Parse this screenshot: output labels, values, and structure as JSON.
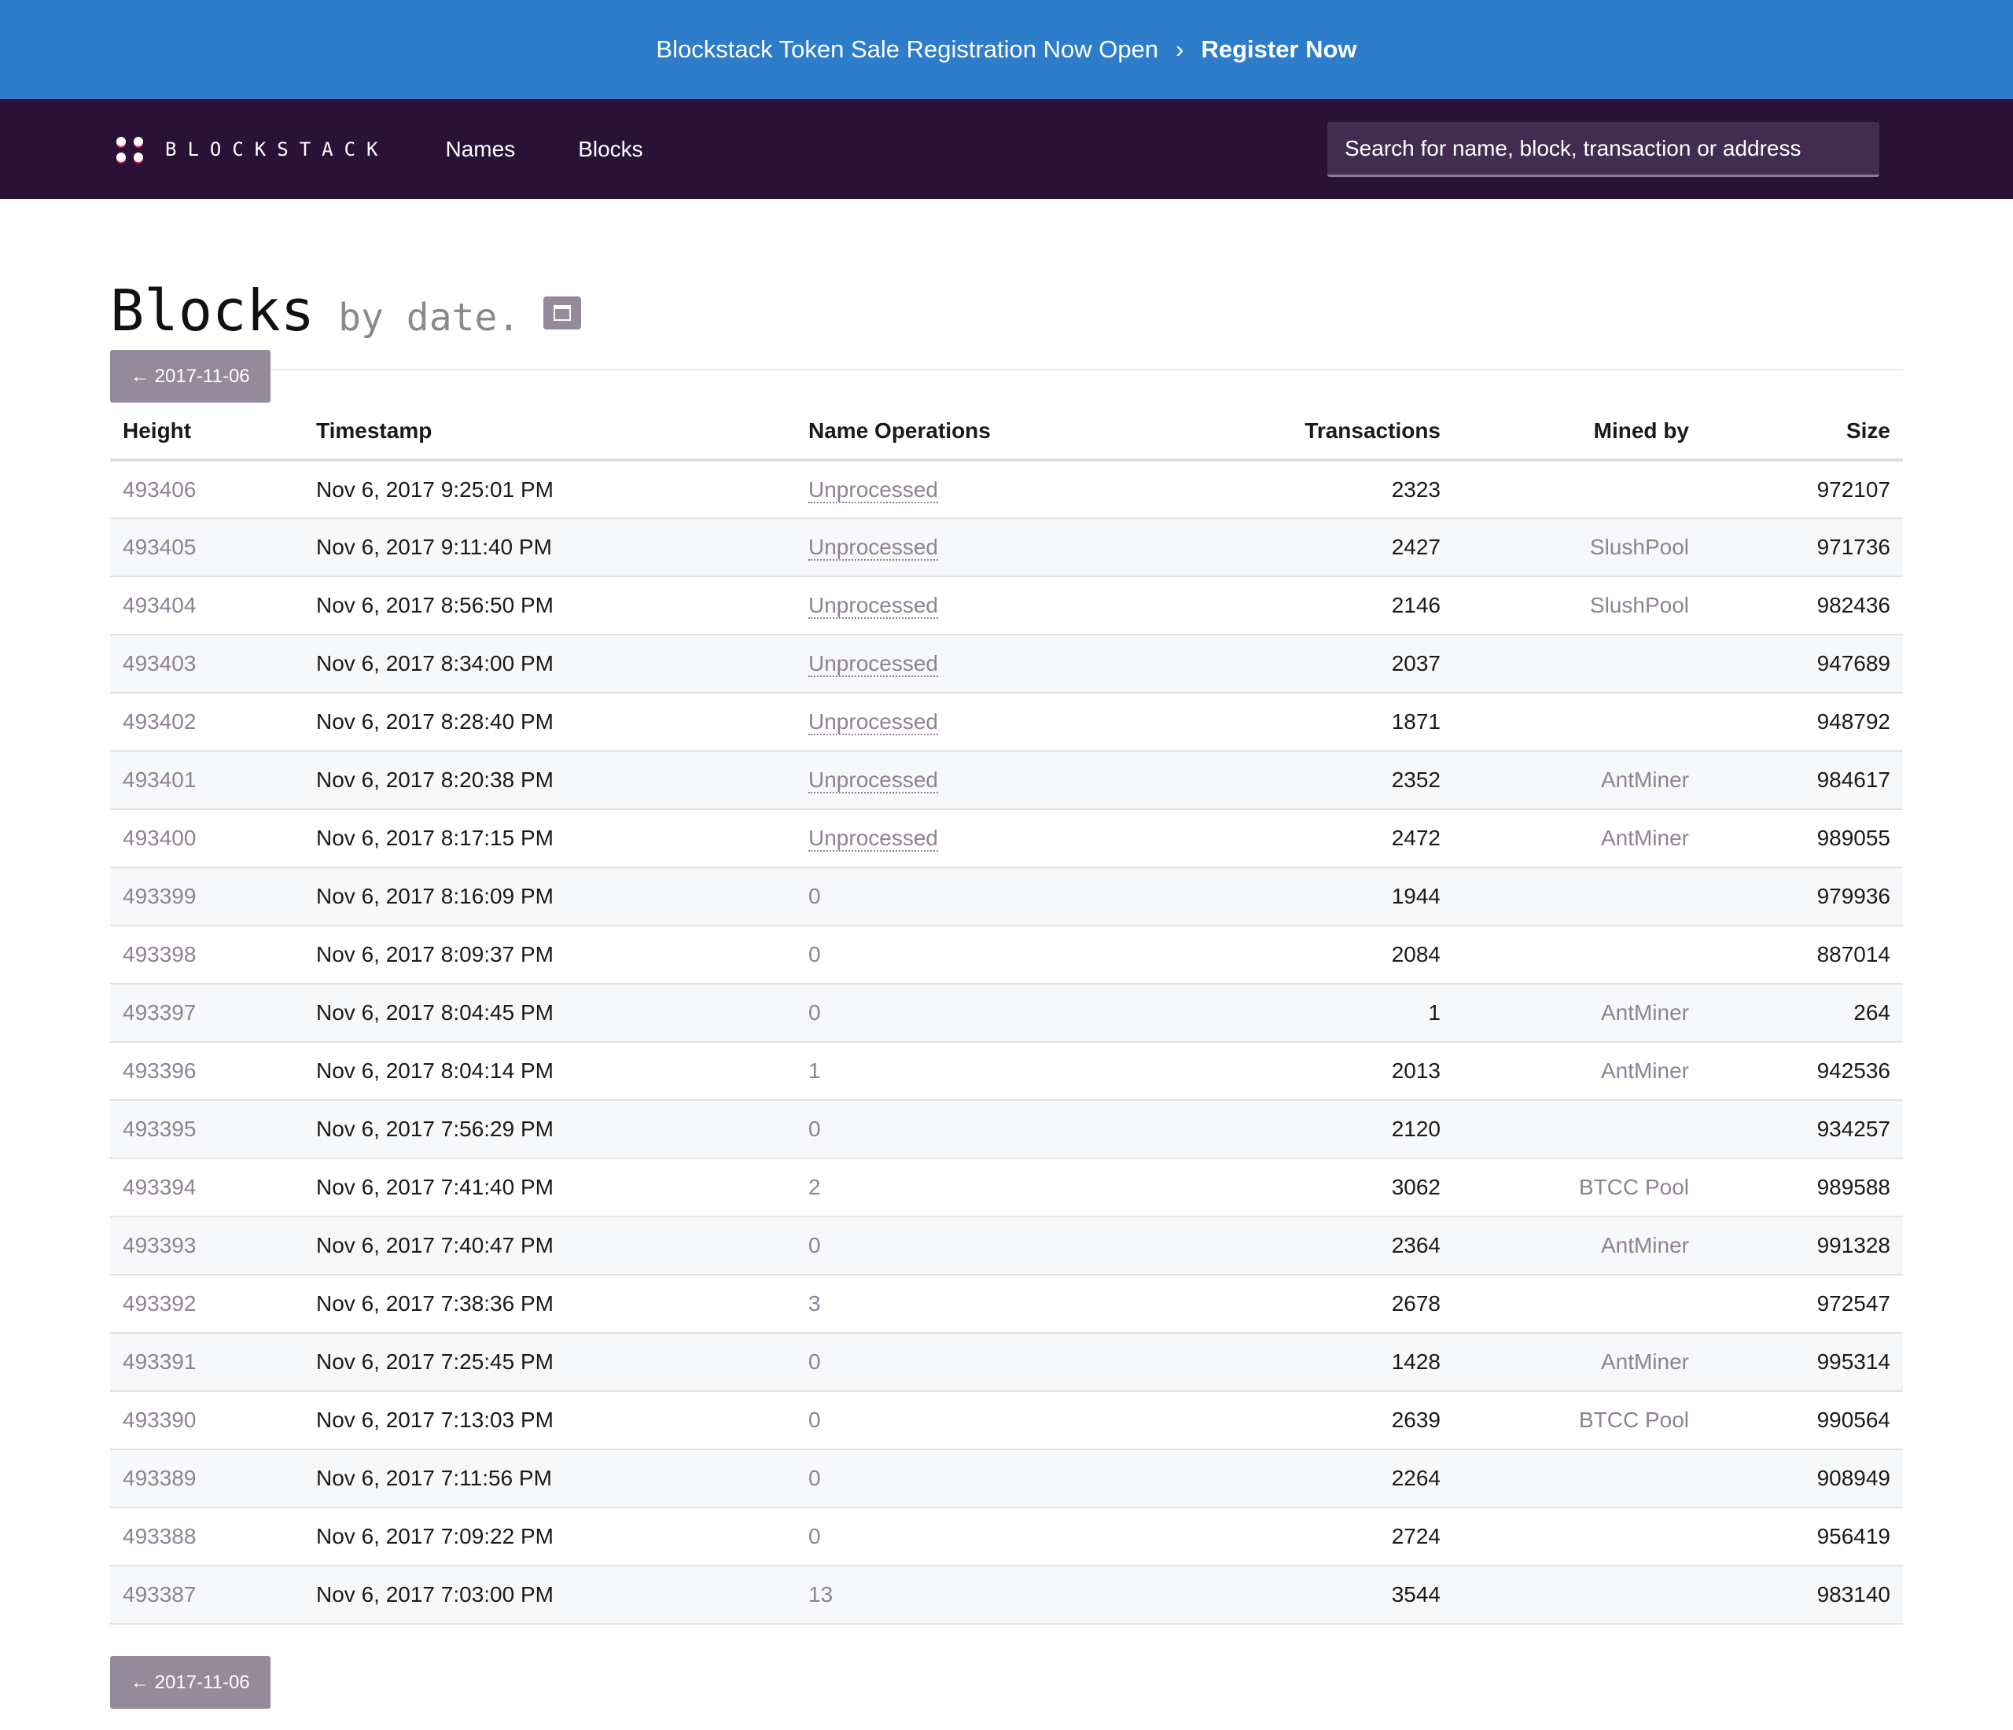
{
  "banner": {
    "text": "Blockstack Token Sale Registration Now Open",
    "separator": "›",
    "cta": "Register Now"
  },
  "nav": {
    "brand": "BLOCKSTACK",
    "links": [
      "Names",
      "Blocks"
    ],
    "search_placeholder": "Search for name, block, transaction or address"
  },
  "page": {
    "title": "Blocks",
    "subtitle": "by date.",
    "calendar_icon": "calendar-icon",
    "prev_button": "← 2017-11-06"
  },
  "table": {
    "headers": [
      "Height",
      "Timestamp",
      "Name Operations",
      "Transactions",
      "Mined by",
      "Size"
    ],
    "rows": [
      [
        "493406",
        "Nov 6, 2017 9:25:01 PM",
        "Unprocessed",
        "2323",
        "",
        "972107"
      ],
      [
        "493405",
        "Nov 6, 2017 9:11:40 PM",
        "Unprocessed",
        "2427",
        "SlushPool",
        "971736"
      ],
      [
        "493404",
        "Nov 6, 2017 8:56:50 PM",
        "Unprocessed",
        "2146",
        "SlushPool",
        "982436"
      ],
      [
        "493403",
        "Nov 6, 2017 8:34:00 PM",
        "Unprocessed",
        "2037",
        "",
        "947689"
      ],
      [
        "493402",
        "Nov 6, 2017 8:28:40 PM",
        "Unprocessed",
        "1871",
        "",
        "948792"
      ],
      [
        "493401",
        "Nov 6, 2017 8:20:38 PM",
        "Unprocessed",
        "2352",
        "AntMiner",
        "984617"
      ],
      [
        "493400",
        "Nov 6, 2017 8:17:15 PM",
        "Unprocessed",
        "2472",
        "AntMiner",
        "989055"
      ],
      [
        "493399",
        "Nov 6, 2017 8:16:09 PM",
        "0",
        "1944",
        "",
        "979936"
      ],
      [
        "493398",
        "Nov 6, 2017 8:09:37 PM",
        "0",
        "2084",
        "",
        "887014"
      ],
      [
        "493397",
        "Nov 6, 2017 8:04:45 PM",
        "0",
        "1",
        "AntMiner",
        "264"
      ],
      [
        "493396",
        "Nov 6, 2017 8:04:14 PM",
        "1",
        "2013",
        "AntMiner",
        "942536"
      ],
      [
        "493395",
        "Nov 6, 2017 7:56:29 PM",
        "0",
        "2120",
        "",
        "934257"
      ],
      [
        "493394",
        "Nov 6, 2017 7:41:40 PM",
        "2",
        "3062",
        "BTCC Pool",
        "989588"
      ],
      [
        "493393",
        "Nov 6, 2017 7:40:47 PM",
        "0",
        "2364",
        "AntMiner",
        "991328"
      ],
      [
        "493392",
        "Nov 6, 2017 7:38:36 PM",
        "3",
        "2678",
        "",
        "972547"
      ],
      [
        "493391",
        "Nov 6, 2017 7:25:45 PM",
        "0",
        "1428",
        "AntMiner",
        "995314"
      ],
      [
        "493390",
        "Nov 6, 2017 7:13:03 PM",
        "0",
        "2639",
        "BTCC Pool",
        "990564"
      ],
      [
        "493389",
        "Nov 6, 2017 7:11:56 PM",
        "0",
        "2264",
        "",
        "908949"
      ],
      [
        "493388",
        "Nov 6, 2017 7:09:22 PM",
        "0",
        "2724",
        "",
        "956419"
      ],
      [
        "493387",
        "Nov 6, 2017 7:03:00 PM",
        "13",
        "3544",
        "",
        "983140"
      ]
    ]
  },
  "colors": {
    "banner": "#2d7dcb",
    "nav": "#2a1136",
    "link": "#8e8294",
    "button": "#958a9c"
  }
}
